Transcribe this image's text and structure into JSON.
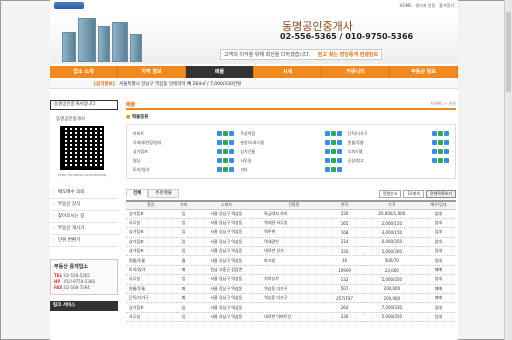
{
  "colors": {
    "accent": "#f08a1e",
    "nav_active": "#333333",
    "badge_blue": "#3a8fd8",
    "badge_green": "#35a35b"
  },
  "top_links": [
    "HOME",
    "관리자 인증",
    "즐겨찾기"
  ],
  "banner": {
    "title": "동명공인중개사",
    "phone": "02-556-5365 / 010-9750-5366",
    "slogan": "고객의 이익을 위해 최선을 다하겠습니다.",
    "slogan_highlight": "믿고 찾는 명당중개 컨설턴트"
  },
  "nav": [
    "업소 소개",
    "지역 정보",
    "매물",
    "시세",
    "커뮤니티",
    "부동산 정보"
  ],
  "nav_active_index": 2,
  "ticker": {
    "tag": "[상가정보]",
    "text": "서울특별시 강남구 역삼동 인테리어 빼   264㎡ / 7,000/330만원"
  },
  "sidebar": {
    "agent_box": "동명공인중개사입니다",
    "agent_name": "동명공인중개사",
    "qr_url": "http://m.sansu.co.kr/stockp",
    "menu": [
      "매도매수 의뢰",
      "부동산 상식",
      "찾아오시는 길",
      "부동산 게시기",
      "단위 변환기"
    ],
    "contact": {
      "title": "부동산 중개업소",
      "lines": [
        {
          "label": "TEL",
          "value": "02-556-5365"
        },
        {
          "label": "HP",
          "value": "010-9750-5366"
        },
        {
          "label": "FAX",
          "value": "02-568-7394"
        }
      ]
    },
    "link_service": "링크 서비스"
  },
  "main": {
    "title": "매물",
    "breadcrumb": "HOME > 매물",
    "category_head": "매물종류",
    "categories": [
      "아파트",
      "주상복합",
      "단독/다가구",
      "다세대/연립/빌라",
      "분양/오피스텔",
      "원룸/투룸",
      "상가점포",
      "상가건물",
      "오피스텔",
      "빌딩",
      "사무실",
      "공장/창고",
      "토지/임야",
      "기타",
      ""
    ],
    "list_head": "전체매물",
    "tabs": [
      "전체",
      "추천매물"
    ],
    "controls": {
      "sort": "정렬순서",
      "count": "10개씩",
      "period": "전체목록보기"
    },
    "columns": [
      "종류",
      "거래",
      "소재지",
      "건물명",
      "면적",
      "가격",
      "매수/임대"
    ],
    "rows": [
      [
        "상가점포",
        "임",
        "서울 강남구 역삼동",
        "특급대지 자리",
        "330",
        "20,000/1,000",
        "임대"
      ],
      [
        "사무실",
        "임",
        "서울 강남구 역삼동",
        "역세권 사무실",
        "165",
        "2,000/150",
        "임대"
      ],
      [
        "상가점포",
        "임",
        "서울 강남구 역삼동",
        "역주위",
        "168",
        "3,000/150",
        "임대"
      ],
      [
        "상가점포",
        "임",
        "서울 강남구 역삼동",
        "역세권빈",
        "214",
        "6,000/350",
        "임대"
      ],
      [
        "상가점포",
        "임",
        "서울 강남구 역삼동",
        "대로변 상가",
        "330",
        "5,000/300",
        "임대"
      ],
      [
        "원룸/투룸",
        "월",
        "서울 강남구 역삼동",
        "파크빌",
        "16",
        "500/70",
        "임대"
      ],
      [
        "토지/임야",
        "매",
        "전남 고흥군 점암면",
        "",
        "10909",
        "23,000",
        "매매"
      ],
      [
        "사무실",
        "임",
        "서울 강남구 역삼동",
        "지하상가",
        "132",
        "5,000/350",
        "임대"
      ],
      [
        "원룸/투룸",
        "매",
        "서울 강남구 역삼동",
        "역삼동 다가구",
        "507",
        "200,000",
        "매매"
      ],
      [
        "단독/다가구",
        "매",
        "서울 강남구 역삼동",
        "역삼동 다가구",
        "257/707",
        "200,000",
        "매매"
      ],
      [
        "상가점포",
        "임",
        "서울 강남구 역삼동",
        "",
        "264",
        "7,000/330",
        "임대"
      ],
      [
        "사무실",
        "임",
        "서울 강남구 역삼동",
        "대로변 아파트인",
        "330",
        "5,000/350",
        "임대"
      ]
    ]
  }
}
